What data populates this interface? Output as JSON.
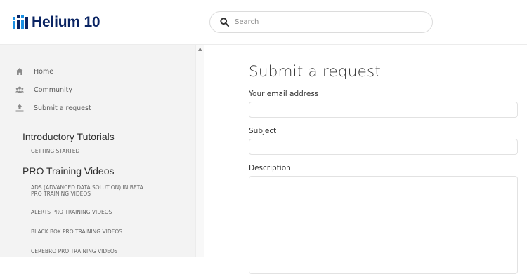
{
  "header": {
    "logo_text": "Helium 10",
    "logo_icon": "helium10-logo-mark",
    "search": {
      "placeholder": "Search",
      "icon": "search-icon"
    }
  },
  "sidebar": {
    "nav_items": [
      {
        "label": "Home",
        "icon": "home-icon"
      },
      {
        "label": "Community",
        "icon": "community-icon"
      },
      {
        "label": "Submit a request",
        "icon": "upload-icon"
      }
    ],
    "sections": [
      {
        "title": "Introductory Tutorials",
        "links": [
          "GETTING STARTED"
        ]
      },
      {
        "title": "PRO Training Videos",
        "links": [
          "ADS (ADVANCED DATA SOLUTION) IN BETA",
          "PRO TRAINING VIDEOS",
          "ALERTS PRO TRAINING VIDEOS",
          "BLACK BOX PRO TRAINING VIDEOS",
          "CEREBRO PRO TRAINING VIDEOS"
        ]
      }
    ]
  },
  "main": {
    "title": "Submit a request",
    "fields": {
      "email_label": "Your email address",
      "subject_label": "Subject",
      "description_label": "Description"
    }
  },
  "colors": {
    "brand_navy": "#0a2463",
    "brand_blue": "#1a8fe3",
    "sidebar_bg": "#f3f3f3"
  }
}
